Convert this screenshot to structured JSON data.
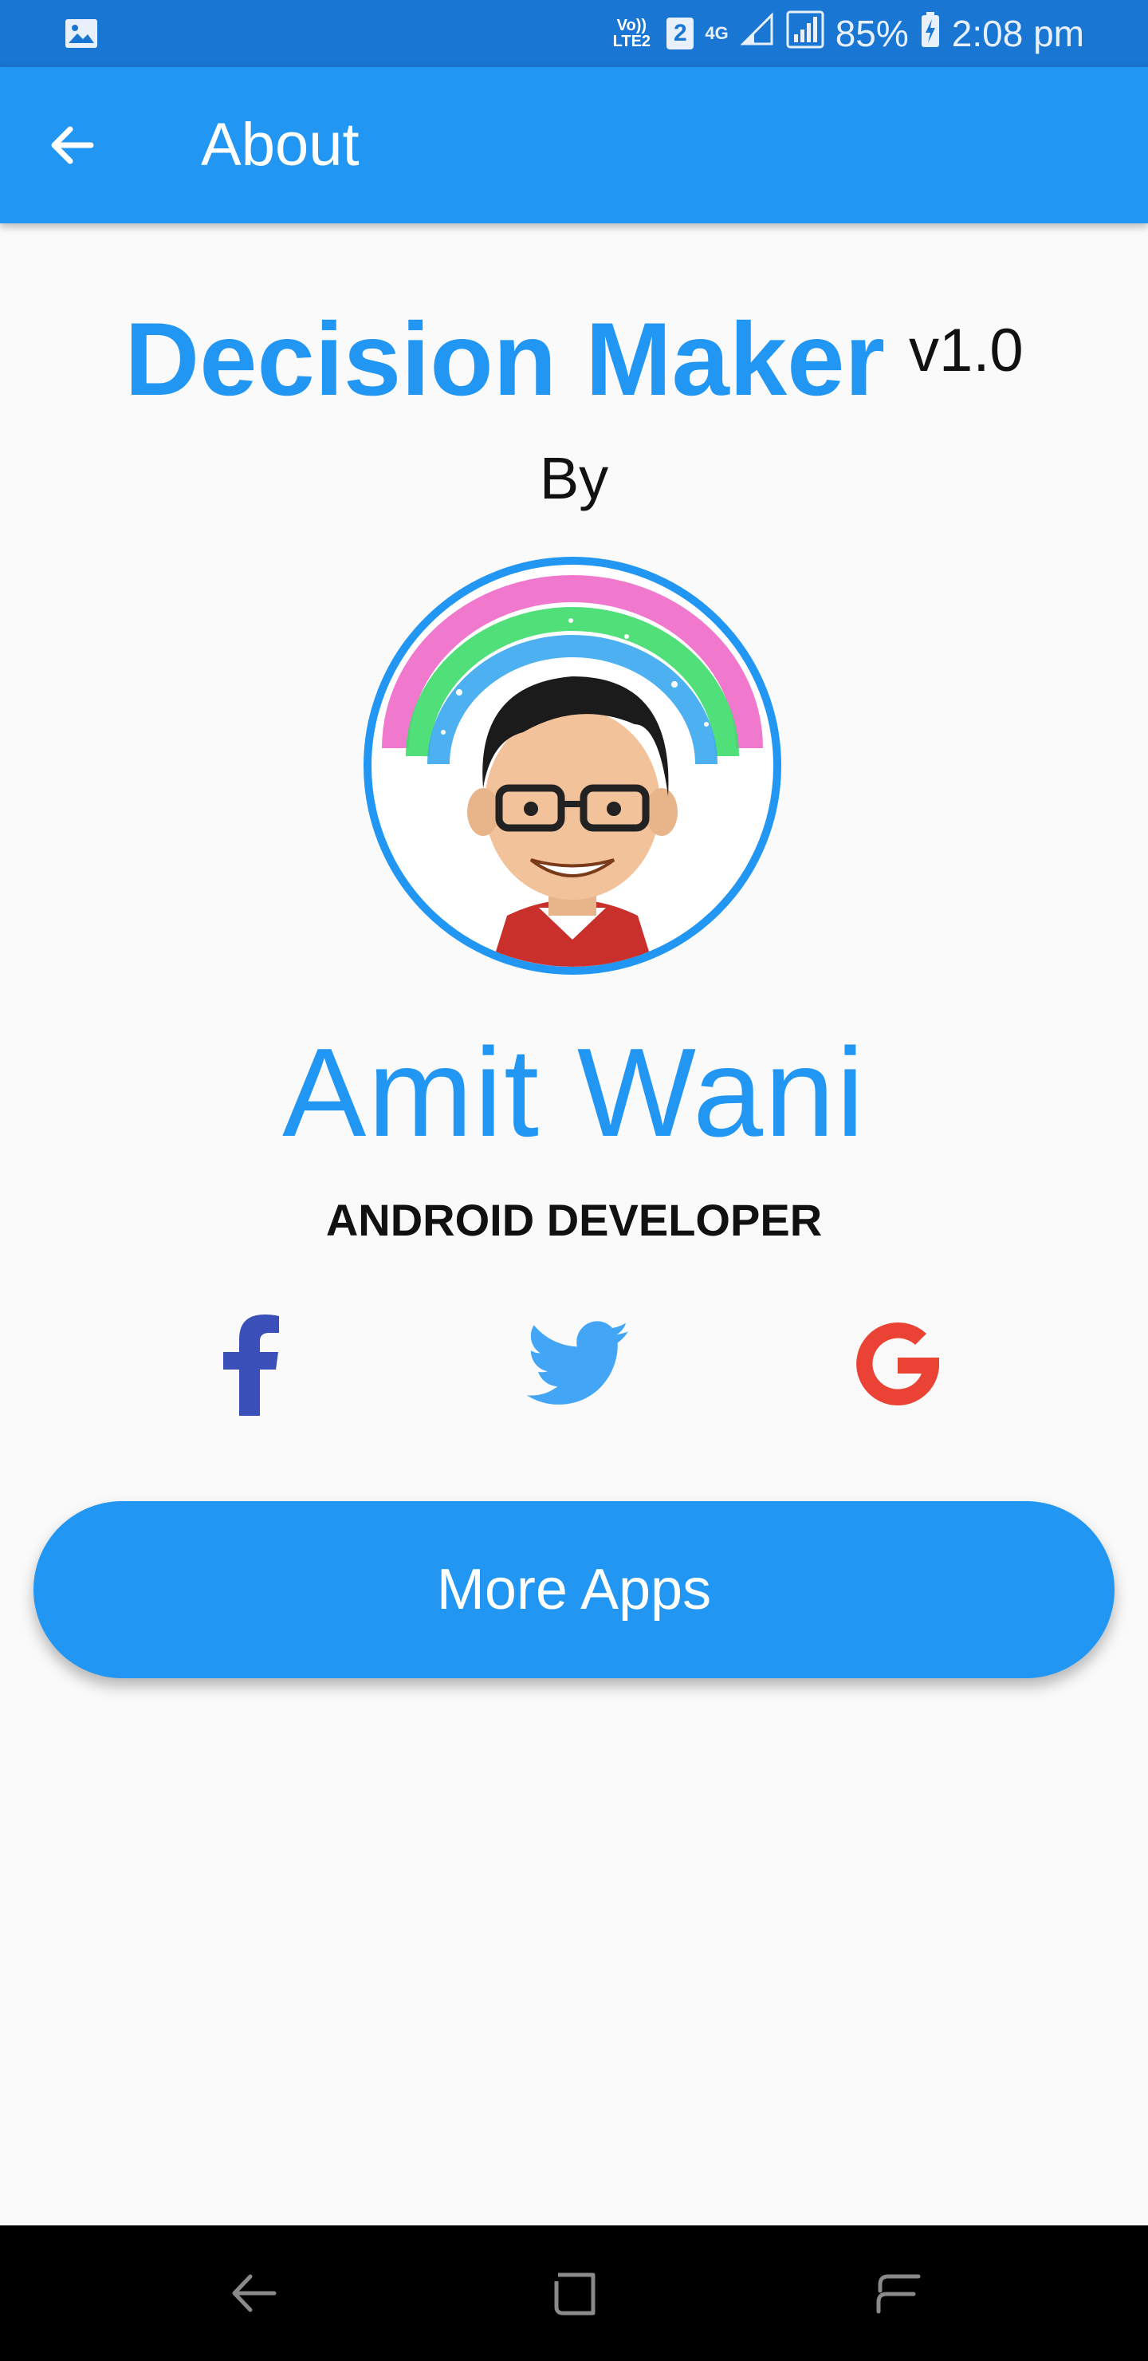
{
  "status_bar": {
    "volte": "Vo)) LTE2",
    "sim": "2",
    "network": "4G",
    "battery": "85%",
    "time": "2:08 pm"
  },
  "app_bar": {
    "title": "About"
  },
  "about": {
    "app_name": "Decision Maker",
    "version": "v1.0",
    "by": "By",
    "developer_name": "Amit Wani",
    "developer_role": "ANDROID DEVELOPER",
    "more_apps_label": "More Apps"
  },
  "social": [
    {
      "icon": "facebook-icon",
      "color": "#3b4fb8"
    },
    {
      "icon": "twitter-icon",
      "color": "#42a5f5"
    },
    {
      "icon": "google-icon",
      "color": "#ea4335"
    }
  ],
  "colors": {
    "primary": "#2196f3",
    "status_bar": "#1976d2",
    "background": "#fafafa"
  },
  "nav_bar": {
    "icons": [
      "nav-back-icon",
      "nav-home-icon",
      "nav-recents-icon"
    ]
  }
}
